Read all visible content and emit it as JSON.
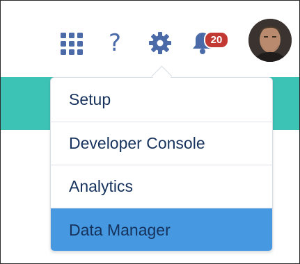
{
  "header": {
    "icons": {
      "apps": "app-launcher-icon",
      "help": "help-icon",
      "setup": "gear-icon",
      "notifications": "bell-icon"
    },
    "help_glyph": "?",
    "notification_count": "20"
  },
  "setup_menu": {
    "items": [
      {
        "label": "Setup"
      },
      {
        "label": "Developer Console"
      },
      {
        "label": "Analytics"
      },
      {
        "label": "Data Manager",
        "highlighted": true
      }
    ]
  },
  "colors": {
    "brand_band": "#3cc3b5",
    "icon": "#4a6aa8",
    "badge": "#c23934",
    "highlight": "#4699e0",
    "text": "#16325c"
  }
}
